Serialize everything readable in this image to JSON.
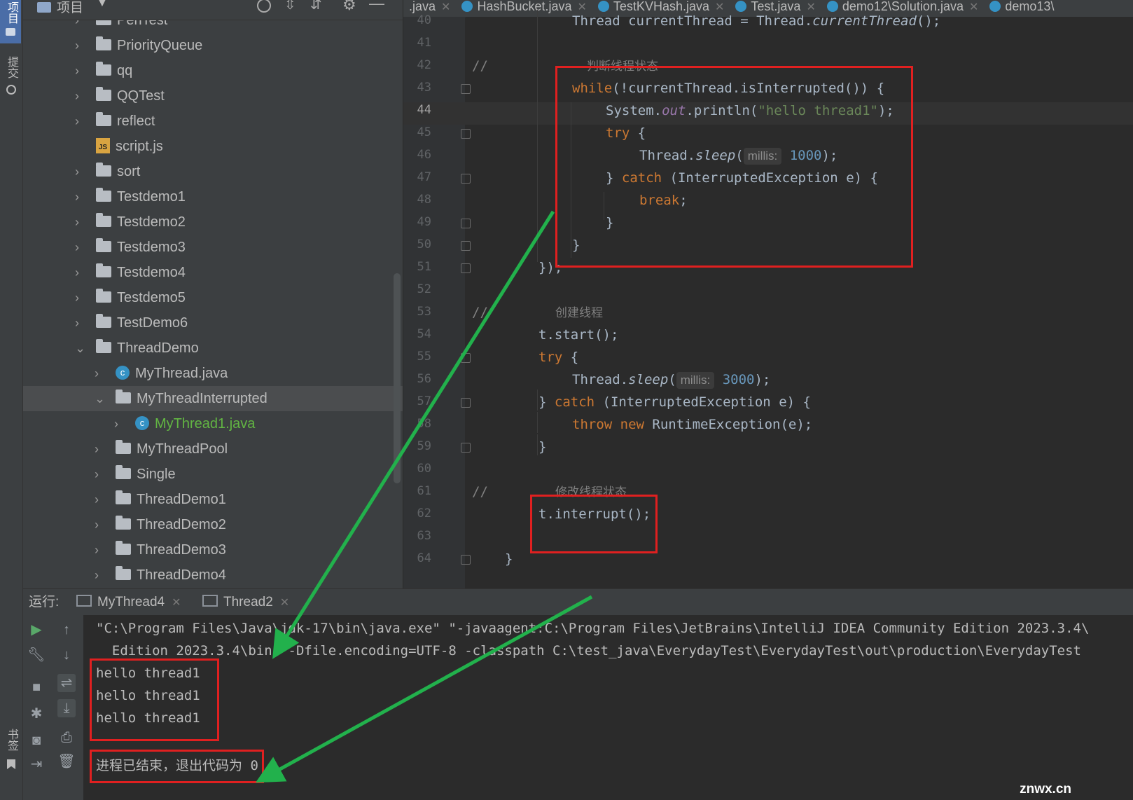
{
  "sidebar": {
    "project_tab": "项目",
    "commit_tab": "提交",
    "bookmarks_tab": "书签"
  },
  "tree_header": {
    "title": "项目"
  },
  "tree": [
    {
      "label": "PenTest",
      "type": "folder",
      "level": 1,
      "expanded": false
    },
    {
      "label": "PriorityQueue",
      "type": "folder",
      "level": 1,
      "expanded": false
    },
    {
      "label": "qq",
      "type": "folder",
      "level": 1,
      "expanded": false
    },
    {
      "label": "QQTest",
      "type": "folder",
      "level": 1,
      "expanded": false
    },
    {
      "label": "reflect",
      "type": "folder",
      "level": 1,
      "expanded": false
    },
    {
      "label": "script.js",
      "type": "js",
      "level": 1,
      "expanded": false
    },
    {
      "label": "sort",
      "type": "folder",
      "level": 1,
      "expanded": false
    },
    {
      "label": "Testdemo1",
      "type": "folder",
      "level": 1,
      "expanded": false
    },
    {
      "label": "Testdemo2",
      "type": "folder",
      "level": 1,
      "expanded": false
    },
    {
      "label": "Testdemo3",
      "type": "folder",
      "level": 1,
      "expanded": false
    },
    {
      "label": "Testdemo4",
      "type": "folder",
      "level": 1,
      "expanded": false
    },
    {
      "label": "Testdemo5",
      "type": "folder",
      "level": 1,
      "expanded": false
    },
    {
      "label": "TestDemo6",
      "type": "folder",
      "level": 1,
      "expanded": false
    },
    {
      "label": "ThreadDemo",
      "type": "folder",
      "level": 1,
      "expanded": true
    },
    {
      "label": "MyThread.java",
      "type": "java",
      "level": 2,
      "expanded": false
    },
    {
      "label": "MyThreadInterrupted",
      "type": "folder",
      "level": 2,
      "expanded": true,
      "selected": true
    },
    {
      "label": "MyThread1.java",
      "type": "java",
      "level": 3,
      "expanded": false,
      "highlight": true
    },
    {
      "label": "MyThreadPool",
      "type": "folder",
      "level": 2,
      "expanded": false
    },
    {
      "label": "Single",
      "type": "folder",
      "level": 2,
      "expanded": false
    },
    {
      "label": "ThreadDemo1",
      "type": "folder",
      "level": 2,
      "expanded": false
    },
    {
      "label": "ThreadDemo2",
      "type": "folder",
      "level": 2,
      "expanded": false
    },
    {
      "label": "ThreadDemo3",
      "type": "folder",
      "level": 2,
      "expanded": false
    },
    {
      "label": "ThreadDemo4",
      "type": "folder",
      "level": 2,
      "expanded": false
    }
  ],
  "editor_tabs": [
    {
      "label": ".java",
      "icon": false
    },
    {
      "label": "HashBucket.java",
      "icon": true
    },
    {
      "label": "TestKVHash.java",
      "icon": true
    },
    {
      "label": "Test.java",
      "icon": true
    },
    {
      "label": "demo12\\Solution.java",
      "icon": true
    },
    {
      "label": "demo13\\",
      "icon": true
    }
  ],
  "editor": {
    "current_line": "44",
    "line_numbers": [
      "40",
      "41",
      "42",
      "43",
      "44",
      "45",
      "46",
      "47",
      "48",
      "49",
      "50",
      "51",
      "52",
      "53",
      "54",
      "55",
      "56",
      "57",
      "58",
      "59",
      "60",
      "61",
      "62",
      "63",
      "64"
    ],
    "lines": {
      "l40": {
        "a": "Thread currentThread = Thread.",
        "b": "currentThread",
        "c": "();"
      },
      "l42": {
        "slash": "//",
        "comment": "判断线程状态"
      },
      "l43": {
        "kw": "while",
        "rest": "(!currentThread.isInterrupted()) {"
      },
      "l44": {
        "a": "System.",
        "fld": "out",
        "b": ".println(",
        "str": "\"hello thread1\"",
        "c": ");"
      },
      "l45": {
        "kw": "try",
        "rest": " {"
      },
      "l46": {
        "a": "Thread.",
        "m": "sleep",
        "b": "(",
        "hint": "millis:",
        "num": "1000",
        "c": ");"
      },
      "l47": {
        "a": "} ",
        "kw": "catch",
        "rest": " (InterruptedException e) {"
      },
      "l48": {
        "kw": "break",
        "rest": ";"
      },
      "l49": {
        "t": "}"
      },
      "l50": {
        "t": "}"
      },
      "l51": {
        "t": "});"
      },
      "l53": {
        "slash": "//",
        "comment": "创建线程"
      },
      "l54": {
        "t": "t.start();"
      },
      "l55": {
        "kw": "try",
        "rest": " {"
      },
      "l56": {
        "a": "Thread.",
        "m": "sleep",
        "b": "(",
        "hint": "millis:",
        "num": "3000",
        "c": ");"
      },
      "l57": {
        "a": "} ",
        "kw": "catch",
        "rest": " (InterruptedException e) {"
      },
      "l58": {
        "kw1": "throw",
        "kw2": "new",
        "rest": " RuntimeException(e);"
      },
      "l59": {
        "t": "}"
      },
      "l61": {
        "slash": "//",
        "comment": "修改线程状态"
      },
      "l62": {
        "t": "t.interrupt();"
      },
      "l64": {
        "t": "}"
      }
    }
  },
  "run_panel": {
    "label": "运行:",
    "tabs": [
      "MyThread4",
      "Thread2"
    ],
    "console": {
      "cmd1": "\"C:\\Program Files\\Java\\jdk-17\\bin\\java.exe\" \"-javaagent:C:\\Program Files\\JetBrains\\IntelliJ IDEA Community Edition 2023.3.4\\",
      "cmd2": "  Edition 2023.3.4\\bin\" -Dfile.encoding=UTF-8 -classpath C:\\test_java\\EverydayTest\\EverydayTest\\out\\production\\EverydayTest",
      "output": [
        "hello thread1",
        "hello thread1",
        "hello thread1"
      ],
      "exit": "进程已结束，退出代码为 0"
    }
  },
  "colors": {
    "annotation_box": "#e02020",
    "annotation_arrow": "#22b14c",
    "keyword": "#cc7832",
    "string": "#6a8759",
    "number": "#6897bb"
  },
  "watermark": "znwx.cn"
}
